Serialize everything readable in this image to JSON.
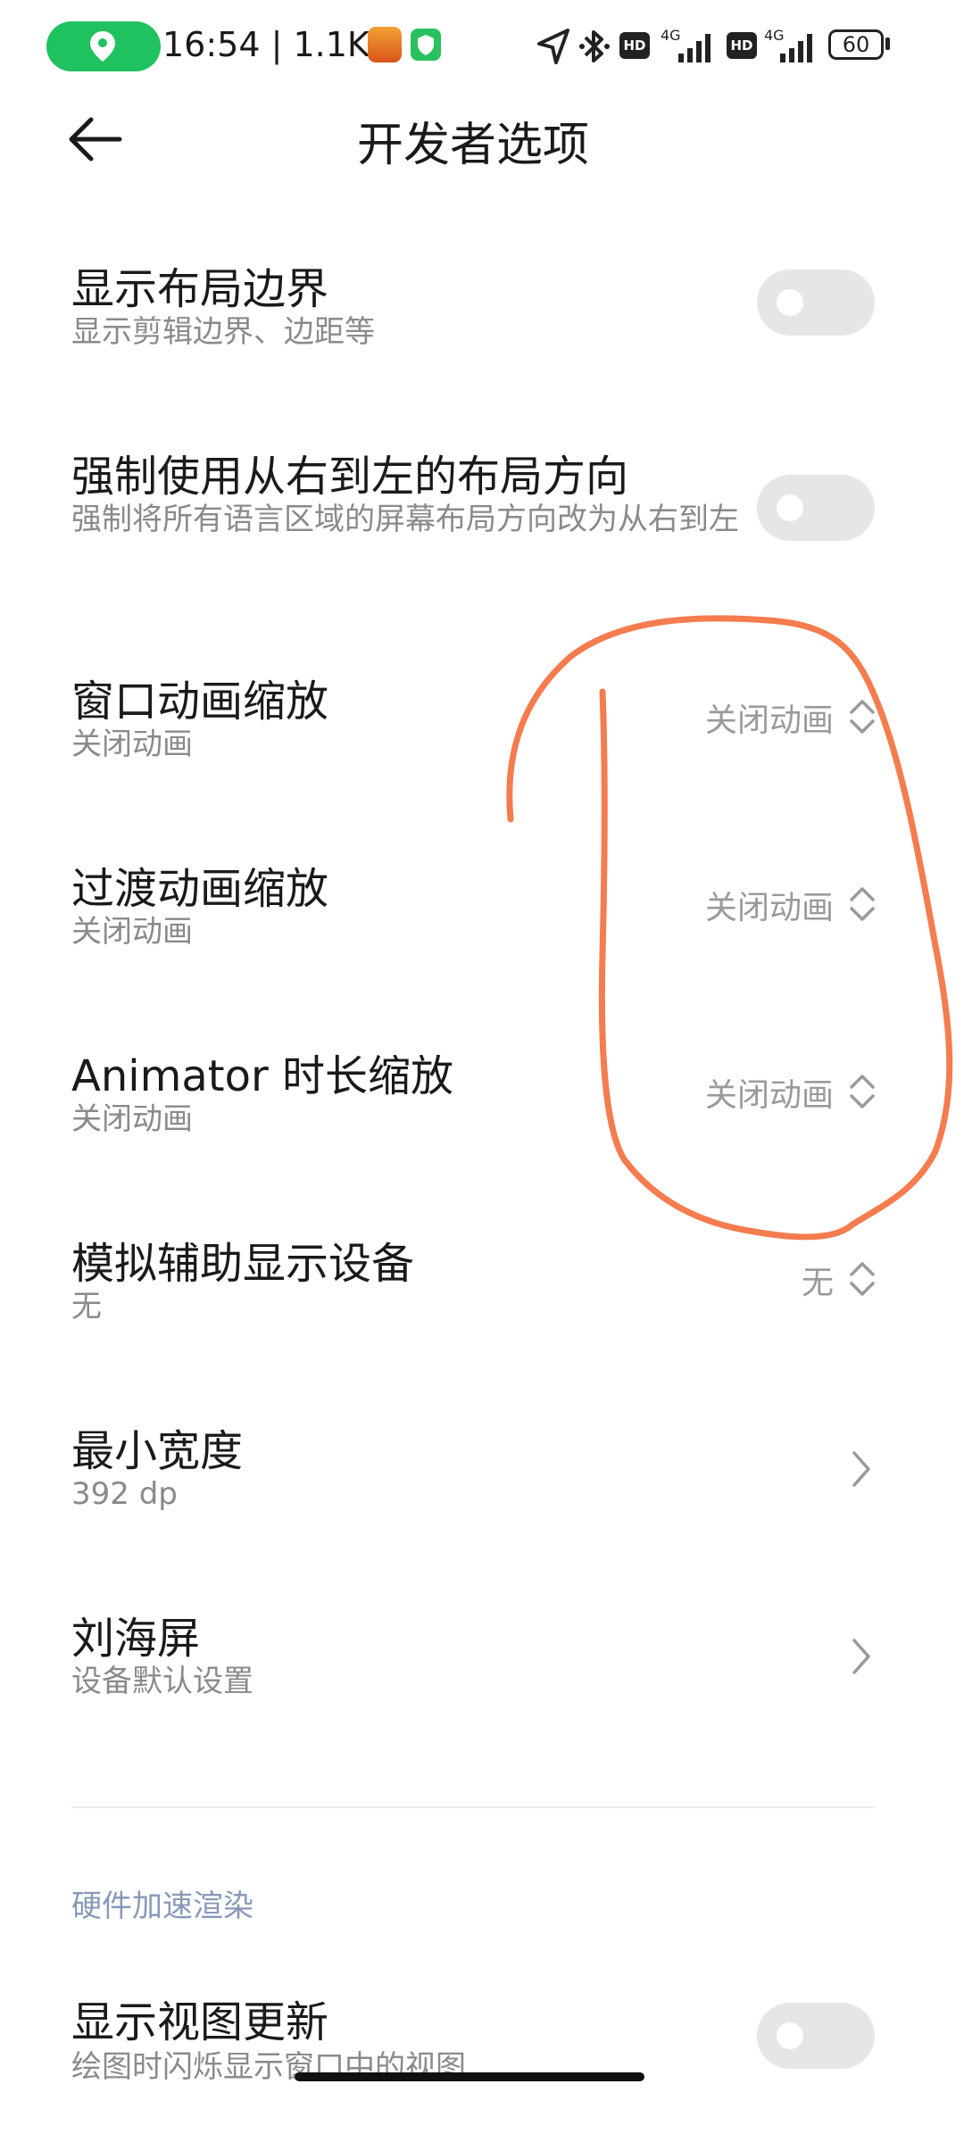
{
  "status_bar": {
    "time_speed": "16:54 | 1.1K/s",
    "network_1": "4G",
    "network_2": "4G",
    "hd_1": "HD",
    "hd_2": "HD",
    "battery": "60"
  },
  "header": {
    "title": "开发者选项"
  },
  "settings": [
    {
      "title": "显示布局边界",
      "subtitle": "显示剪辑边界、边距等",
      "control": "toggle",
      "on": false
    },
    {
      "title": "强制使用从右到左的布局方向",
      "subtitle": "强制将所有语言区域的屏幕布局方向改为从右到左",
      "control": "toggle",
      "on": false
    },
    {
      "title": "窗口动画缩放",
      "subtitle": "关闭动画",
      "control": "select",
      "value": "关闭动画"
    },
    {
      "title": "过渡动画缩放",
      "subtitle": "关闭动画",
      "control": "select",
      "value": "关闭动画"
    },
    {
      "title": "Animator 时长缩放",
      "subtitle": "关闭动画",
      "control": "select",
      "value": "关闭动画"
    },
    {
      "title": "模拟辅助显示设备",
      "subtitle": "无",
      "control": "select",
      "value": "无"
    },
    {
      "title": "最小宽度",
      "subtitle": "392 dp",
      "control": "link"
    },
    {
      "title": "刘海屏",
      "subtitle": "设备默认设置",
      "control": "link"
    }
  ],
  "section": {
    "header": "硬件加速渲染"
  },
  "section_items": [
    {
      "title": "显示视图更新",
      "subtitle": "绘图时闪烁显示窗口中的视图",
      "control": "toggle",
      "on": false
    }
  ],
  "colors": {
    "accent_green": "#1fc25e",
    "annotation_stroke": "#f47c4e",
    "toggle_off": "#e6e6e6",
    "section_header": "#8799b8"
  },
  "icons": {
    "back": "back-arrow-icon",
    "select": "up-down-chevron-icon",
    "link": "chevron-right-icon",
    "location": "location-pin-icon"
  }
}
